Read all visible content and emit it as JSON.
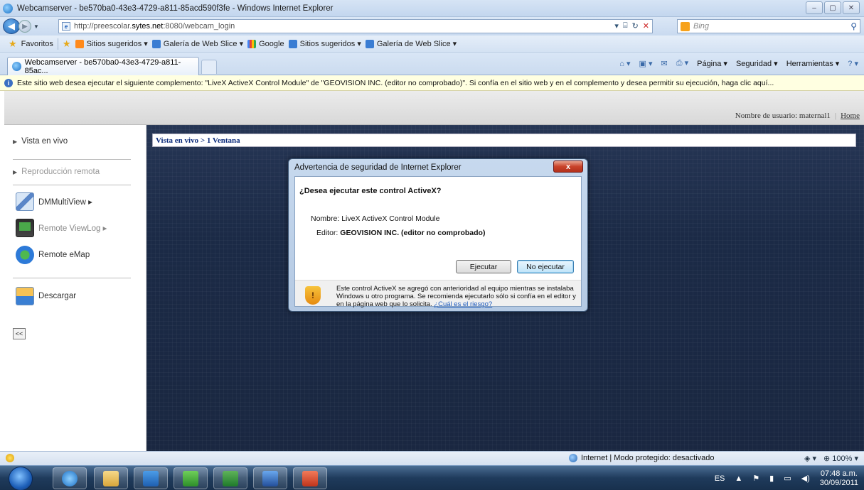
{
  "window": {
    "title": "Webcamserver - be570ba0-43e3-4729-a811-85acd590f3fe - Windows Internet Explorer"
  },
  "address": {
    "url_prefix": "http://preescolar.",
    "url_domain": "sytes.net",
    "url_suffix": ":8080/webcam_login",
    "search_placeholder": "Bing"
  },
  "favorites": {
    "label": "Favoritos",
    "items": [
      "Sitios sugeridos ▾",
      "Galería de Web Slice ▾",
      "Google",
      "Sitios sugeridos ▾",
      "Galería de Web Slice ▾"
    ]
  },
  "tab": {
    "label": "Webcamserver - be570ba0-43e3-4729-a811-85ac..."
  },
  "commandbar": {
    "page": "Página ▾",
    "security": "Seguridad ▾",
    "tools": "Herramientas ▾"
  },
  "infobar": {
    "text": "Este sitio web desea ejecutar el siguiente complemento: \"LiveX ActiveX Control Module\" de \"GEOVISION INC. (editor no comprobado)\". Si confía en el sitio web y en el complemento y desea permitir su ejecución, haga clic aquí..."
  },
  "header": {
    "user_label": "Nombre de usuario: maternal1",
    "home_link": "Home"
  },
  "sidebar": {
    "live_view": "Vista en vivo",
    "remote_playback": "Reproducción remota",
    "dmmultiview": "DMMultiView ▸",
    "remote_viewlog": "Remote ViewLog ▸",
    "remote_emap": "Remote eMap",
    "download": "Descargar",
    "collapse": "<<"
  },
  "main": {
    "breadcrumb": "Vista en vivo > 1 Ventana"
  },
  "dialog": {
    "title": "Advertencia de seguridad de Internet Explorer",
    "close": "x",
    "question": "¿Desea ejecutar este control ActiveX?",
    "name_label": "Nombre:",
    "name_value": "LiveX ActiveX Control Module",
    "publisher_label": "Editor:",
    "publisher_value": "GEOVISION INC. (editor no comprobado)",
    "run_button": "Ejecutar",
    "dont_run_button": "No ejecutar",
    "warning_text": "Este control ActiveX se agregó con anterioridad al equipo mientras se instalaba Windows u otro programa. Se recomienda ejecutarlo sólo si confía en el editor y en la página web que lo solicita.",
    "risk_link": "¿Cuál es el riesgo?"
  },
  "statusbar": {
    "zone": "Internet | Modo protegido: desactivado",
    "zoom": "100%"
  },
  "taskbar": {
    "lang": "ES",
    "time": "07:48 a.m.",
    "date": "30/09/2011"
  }
}
